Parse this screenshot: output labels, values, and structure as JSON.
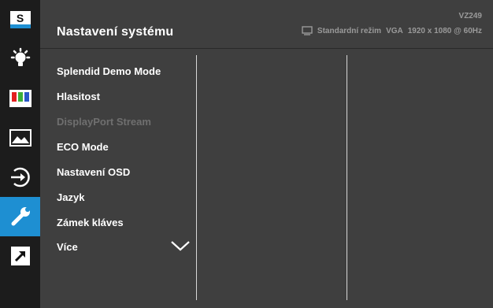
{
  "header": {
    "title": "Nastavení systému",
    "model": "VZ249",
    "mode": "Standardní režim",
    "input": "VGA",
    "resolution": "1920 x 1080 @ 60Hz"
  },
  "sidebar": {
    "items": [
      {
        "icon": "splendid-s-icon",
        "label": "S"
      },
      {
        "icon": "eye-care-bulb-icon"
      },
      {
        "icon": "color-bars-icon"
      },
      {
        "icon": "image-icon"
      },
      {
        "icon": "input-select-icon"
      },
      {
        "icon": "wrench-icon",
        "active": true
      },
      {
        "icon": "shortcut-arrow-icon"
      }
    ]
  },
  "menu": {
    "items": [
      {
        "label": "Splendid Demo Mode",
        "enabled": true
      },
      {
        "label": "Hlasitost",
        "enabled": true
      },
      {
        "label": "DisplayPort Stream",
        "enabled": false
      },
      {
        "label": "ECO Mode",
        "enabled": true
      },
      {
        "label": "Nastavení OSD",
        "enabled": true
      },
      {
        "label": "Jazyk",
        "enabled": true
      },
      {
        "label": "Zámek kláves",
        "enabled": true
      },
      {
        "label": "Více",
        "enabled": true
      }
    ]
  },
  "colors": {
    "background": "#3f3f3f",
    "sidebar": "#1c1c1c",
    "accent": "#1e8fd2",
    "disabled_text": "#6f6f6f"
  }
}
